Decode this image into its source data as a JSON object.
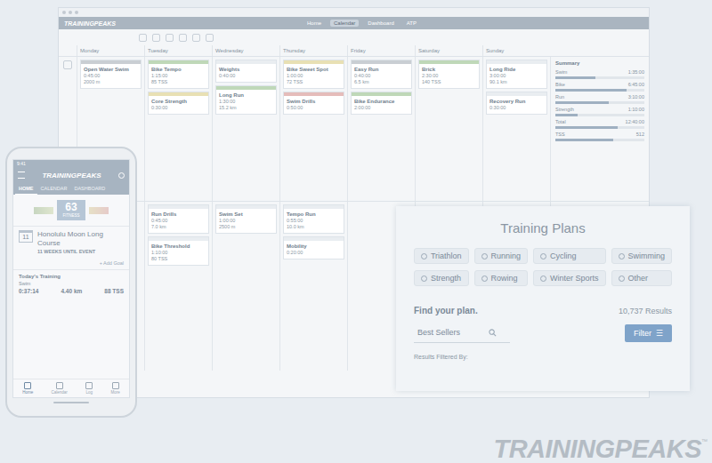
{
  "desktop": {
    "logo": "TRAININGPEAKS",
    "nav": [
      {
        "label": "Home",
        "selected": false
      },
      {
        "label": "Calendar",
        "selected": true
      },
      {
        "label": "Dashboard",
        "selected": false
      },
      {
        "label": "ATP",
        "selected": false
      }
    ],
    "days": [
      "Monday",
      "Tuesday",
      "Wednesday",
      "Thursday",
      "Friday",
      "Saturday",
      "Sunday"
    ],
    "summary_title": "Summary",
    "weeks": [
      {
        "days": [
          [
            {
              "title": "Open Water Swim",
              "lines": [
                "0:45:00",
                "2000 m"
              ],
              "color": "#c9ced3"
            }
          ],
          [
            {
              "title": "Bike Tempo",
              "lines": [
                "1:15:00",
                "85 TSS"
              ],
              "color": "#bfd8b8"
            },
            {
              "title": "Core Strength",
              "lines": [
                "0:30:00"
              ],
              "color": "#e8e0b4"
            }
          ],
          [
            {
              "title": "Weights",
              "lines": [
                "0:40:00"
              ],
              "color": "#e9edf1"
            },
            {
              "title": "Long Run",
              "lines": [
                "1:30:00",
                "15.2 km"
              ],
              "color": "#bfd8b8"
            }
          ],
          [
            {
              "title": "Bike Sweet Spot",
              "lines": [
                "1:00:00",
                "72 TSS"
              ],
              "color": "#e8e0b4"
            },
            {
              "title": "Swim Drills",
              "lines": [
                "0:50:00"
              ],
              "color": "#e5bcba"
            }
          ],
          [
            {
              "title": "Easy Run",
              "lines": [
                "0:40:00",
                "6.5 km"
              ],
              "color": "#c9ced3"
            },
            {
              "title": "Bike Endurance",
              "lines": [
                "2:00:00"
              ],
              "color": "#bfd8b8"
            }
          ],
          [
            {
              "title": "Brick",
              "lines": [
                "2:30:00",
                "140 TSS"
              ],
              "color": "#bfd8b8"
            }
          ],
          [
            {
              "title": "Long Ride",
              "lines": [
                "3:00:00",
                "90.1 km"
              ],
              "color": "#e9edf1"
            },
            {
              "title": "Recovery Run",
              "lines": [
                "0:30:00"
              ],
              "color": "#e9edf1"
            }
          ]
        ]
      },
      {
        "days": [
          [],
          [
            {
              "title": "Run Drills",
              "lines": [
                "0:45:00",
                "7.0 km"
              ],
              "color": "#e9edf1"
            },
            {
              "title": "Bike Threshold",
              "lines": [
                "1:10:00",
                "80 TSS"
              ],
              "color": "#e9edf1"
            }
          ],
          [
            {
              "title": "Swim Set",
              "lines": [
                "1:00:00",
                "2500 m"
              ],
              "color": "#e9edf1"
            }
          ],
          [
            {
              "title": "Tempo Run",
              "lines": [
                "0:55:00",
                "10.0 km"
              ],
              "color": "#e9edf1"
            },
            {
              "title": "Mobility",
              "lines": [
                "0:20:00"
              ],
              "color": "#e9edf1"
            }
          ],
          [],
          [],
          []
        ]
      }
    ],
    "summary": [
      {
        "label": "Swim",
        "value": "1:35:00",
        "level": 0.45
      },
      {
        "label": "Bike",
        "value": "6:45:00",
        "level": 0.8
      },
      {
        "label": "Run",
        "value": "3:10:00",
        "level": 0.6
      },
      {
        "label": "Strength",
        "value": "1:10:00",
        "level": 0.25
      },
      {
        "label": "Total",
        "value": "12:40:00",
        "level": 0.7
      },
      {
        "label": "TSS",
        "value": "512",
        "level": 0.65
      }
    ]
  },
  "phone": {
    "time": "9:41",
    "logo": "TRAININGPEAKS",
    "tabs": [
      {
        "label": "HOME",
        "selected": true
      },
      {
        "label": "CALENDAR",
        "selected": false
      },
      {
        "label": "DASHBOARD",
        "selected": false
      }
    ],
    "fitness": {
      "value": "63",
      "label": "FITNESS"
    },
    "event": {
      "day": "11",
      "name": "Honolulu Moon Long Course",
      "countdown": "11 WEEKS UNTIL EVENT"
    },
    "add_goal": "+ Add Goal",
    "today": {
      "title": "Today's Training",
      "sport": "Swim",
      "stats": [
        "0:37:14",
        "4.40 km",
        "88 TSS"
      ]
    },
    "bottom_nav": [
      {
        "label": "Home",
        "selected": true
      },
      {
        "label": "Calendar",
        "selected": false
      },
      {
        "label": "Log",
        "selected": false
      },
      {
        "label": "More",
        "selected": false
      }
    ]
  },
  "plans": {
    "title": "Training Plans",
    "sports": [
      "Triathlon",
      "Running",
      "Cycling",
      "Swimming",
      "Strength",
      "Rowing",
      "Winter Sports",
      "Other"
    ],
    "find": "Find your plan.",
    "results": "10,737 Results",
    "search": {
      "value": "Best Sellers"
    },
    "filter": "Filter",
    "filter_icon": "☰",
    "filtered_by": "Results Filtered By:"
  },
  "brand": {
    "logo": "TRAININGPEAKS",
    "tm": "™"
  }
}
